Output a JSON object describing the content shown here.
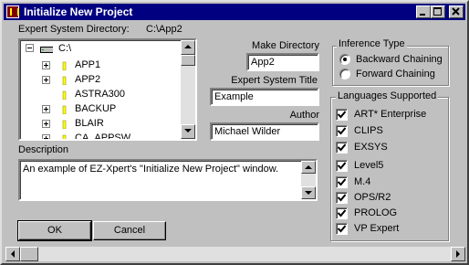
{
  "window": {
    "title": "Initialize New Project"
  },
  "expert_dir": {
    "label": "Expert System Directory:",
    "value": "C:\\App2"
  },
  "tree": {
    "root": "C:\\",
    "items": [
      {
        "label": "APP1",
        "expandable": true
      },
      {
        "label": "APP2",
        "expandable": true
      },
      {
        "label": "ASTRA300",
        "expandable": false
      },
      {
        "label": "BACKUP",
        "expandable": true
      },
      {
        "label": "BLAIR",
        "expandable": true
      },
      {
        "label": "CA_APPSW",
        "expandable": true
      }
    ]
  },
  "make_directory": {
    "label": "Make Directory",
    "value": "App2"
  },
  "expert_title": {
    "label": "Expert System Title",
    "value": "Example"
  },
  "author": {
    "label": "Author",
    "value": "Michael Wilder"
  },
  "description": {
    "label": "Description",
    "value": "An example of EZ-Xpert's \"Initialize New Project\" window."
  },
  "inference": {
    "label": "Inference Type",
    "options": [
      {
        "label": "Backward Chaining",
        "selected": true
      },
      {
        "label": "Forward Chaining",
        "selected": false
      }
    ]
  },
  "languages": {
    "label": "Languages Supported",
    "items": [
      {
        "label": "ART* Enterprise",
        "checked": true
      },
      {
        "label": "CLIPS",
        "checked": true
      },
      {
        "label": "EXSYS",
        "checked": true
      },
      {
        "label": "Level5",
        "checked": true
      },
      {
        "label": "M.4",
        "checked": true
      },
      {
        "label": "OPS/R2",
        "checked": true
      },
      {
        "label": "PROLOG",
        "checked": true
      },
      {
        "label": "VP Expert",
        "checked": true
      }
    ]
  },
  "buttons": {
    "ok": "OK",
    "cancel": "Cancel"
  },
  "colors": {
    "titlebar": "#000080",
    "face": "#c0c0c0",
    "folder": "#ffff00"
  }
}
